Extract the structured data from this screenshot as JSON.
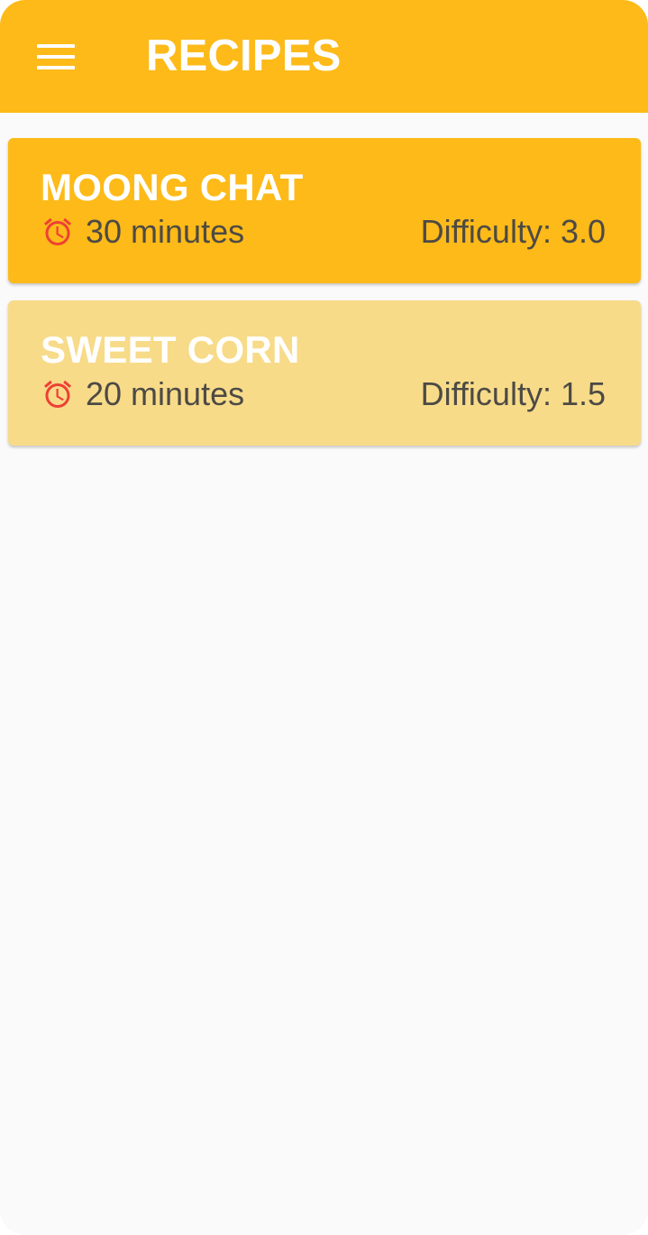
{
  "app": {
    "title": "RECIPES",
    "menu_icon": "hamburger-menu-icon",
    "accent_color": "#fdba18",
    "background_color": "#fafafa"
  },
  "recipes": [
    {
      "name": "MOONG CHAT",
      "time": "30 minutes",
      "difficulty": "Difficulty: 3.0",
      "card_color": "#fdba18",
      "icon": "alarm-clock-icon"
    },
    {
      "name": "SWEET CORN",
      "time": "20 minutes",
      "difficulty": "Difficulty: 1.5",
      "card_color": "#f7db89",
      "icon": "alarm-clock-icon"
    }
  ]
}
